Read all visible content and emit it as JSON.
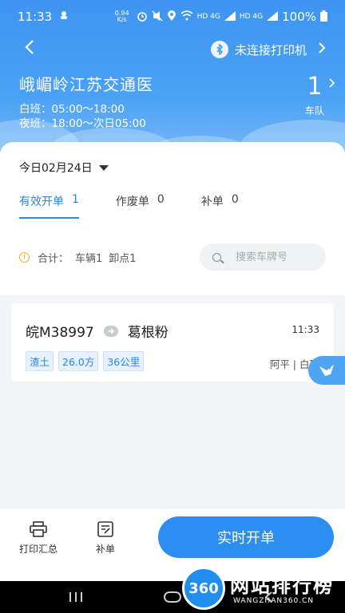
{
  "status": {
    "time": "11:33",
    "speed_value": "0.94",
    "speed_unit": "K/s",
    "network_a": "HD 4G",
    "network_b": "HD 4G",
    "battery": "100%"
  },
  "nav": {
    "back_symbol": "<",
    "printer_status": "未连接打印机",
    "printer_chevron": ">"
  },
  "header": {
    "company": "峨嵋岭江苏交通医",
    "day_shift": "白班：05:00～18:00",
    "night_shift": "夜班：18:00～次日05:00",
    "team_count": "1",
    "team_label": "车队",
    "team_chevron": ">"
  },
  "date_filter": {
    "label": "今日02月24日"
  },
  "tabs": [
    {
      "label": "有效开单",
      "count": "1"
    },
    {
      "label": "作废单",
      "count": "0"
    },
    {
      "label": "补单",
      "count": "0"
    }
  ],
  "summary": {
    "prefix": "合计：",
    "vehicles": "车辆1",
    "points": "卸点1"
  },
  "search": {
    "placeholder": "搜索车牌号"
  },
  "orders": [
    {
      "plate": "皖M38997",
      "destination": "葛根粉",
      "time": "11:33",
      "tags": [
        "渣土",
        "26.0方",
        "36公里"
      ],
      "driver": "阿平 | 白班"
    }
  ],
  "bottom": {
    "print_summary": "打印汇总",
    "supplement": "补单",
    "realtime_order": "实时开单"
  },
  "watermark": {
    "logo_text": "360",
    "title": "网站排行榜",
    "subtitle": "WANGZHAN360.CN"
  },
  "colors": {
    "accent": "#2c8ef0",
    "header_top": "#3e95f2",
    "tag_text": "#2a84ea"
  }
}
